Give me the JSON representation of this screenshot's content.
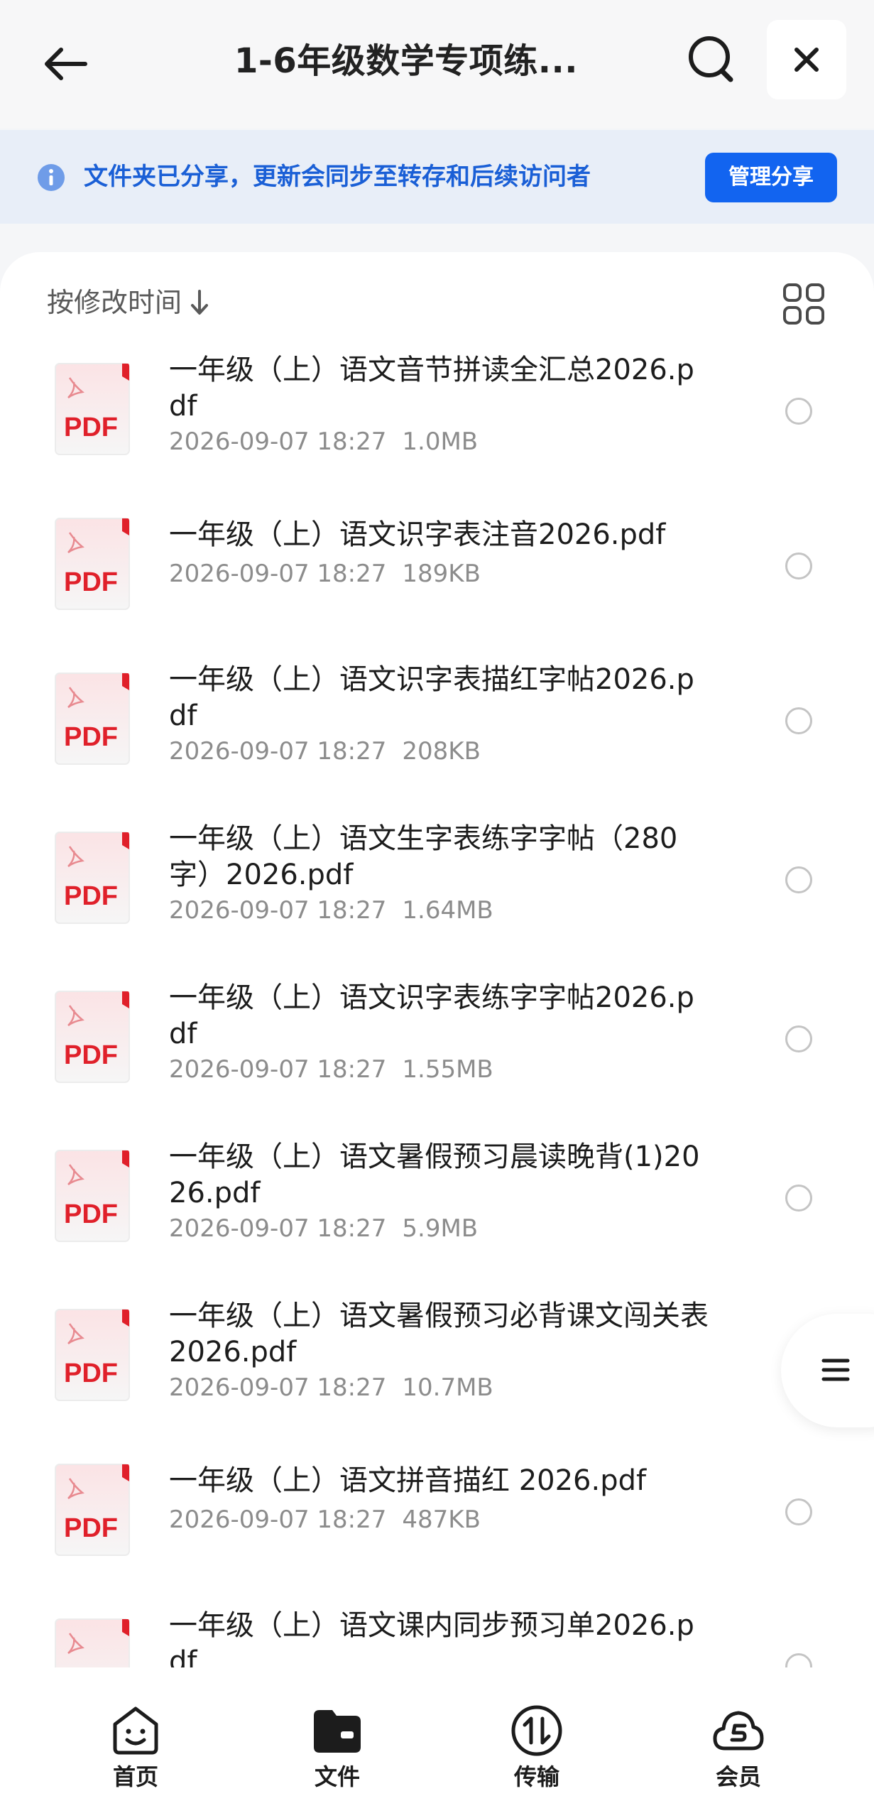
{
  "header": {
    "title": "1-6年级数学专项练..."
  },
  "share_banner": {
    "text": "文件夹已分享，更新会同步至转存和后续访问者",
    "manage_button": "管理分享"
  },
  "toolbar": {
    "sort_label": "按修改时间"
  },
  "files": [
    {
      "name": "一年级（上）语文音节拼读全汇总2026.pdf",
      "date": "2026-09-07 18:27",
      "size": "1.0MB"
    },
    {
      "name": "一年级（上）语文识字表注音2026.pdf",
      "date": "2026-09-07 18:27",
      "size": "189KB"
    },
    {
      "name": "一年级（上）语文识字表描红字帖2026.pdf",
      "date": "2026-09-07 18:27",
      "size": "208KB"
    },
    {
      "name": "一年级（上）语文生字表练字字帖（280字）2026.pdf",
      "date": "2026-09-07 18:27",
      "size": "1.64MB"
    },
    {
      "name": "一年级（上）语文识字表练字字帖2026.pdf",
      "date": "2026-09-07 18:27",
      "size": "1.55MB"
    },
    {
      "name": "一年级（上）语文暑假预习晨读晚背(1)2026.pdf",
      "date": "2026-09-07 18:27",
      "size": "5.9MB"
    },
    {
      "name": "一年级（上）语文暑假预习必背课文闯关表2026.pdf",
      "date": "2026-09-07 18:27",
      "size": "10.7MB"
    },
    {
      "name": "一年级（上）语文拼音描红 2026.pdf",
      "date": "2026-09-07 18:27",
      "size": "487KB"
    },
    {
      "name": "一年级（上）语文课内同步预习单2026.pdf",
      "date": "",
      "size": ""
    }
  ],
  "pdf_label": "PDF",
  "bottom_nav": {
    "home": "首页",
    "files": "文件",
    "transfer": "传输",
    "vip": "会员"
  },
  "colors": {
    "accent": "#1264f0",
    "banner_bg": "#e8eef8",
    "pdf_red": "#e0202a"
  }
}
